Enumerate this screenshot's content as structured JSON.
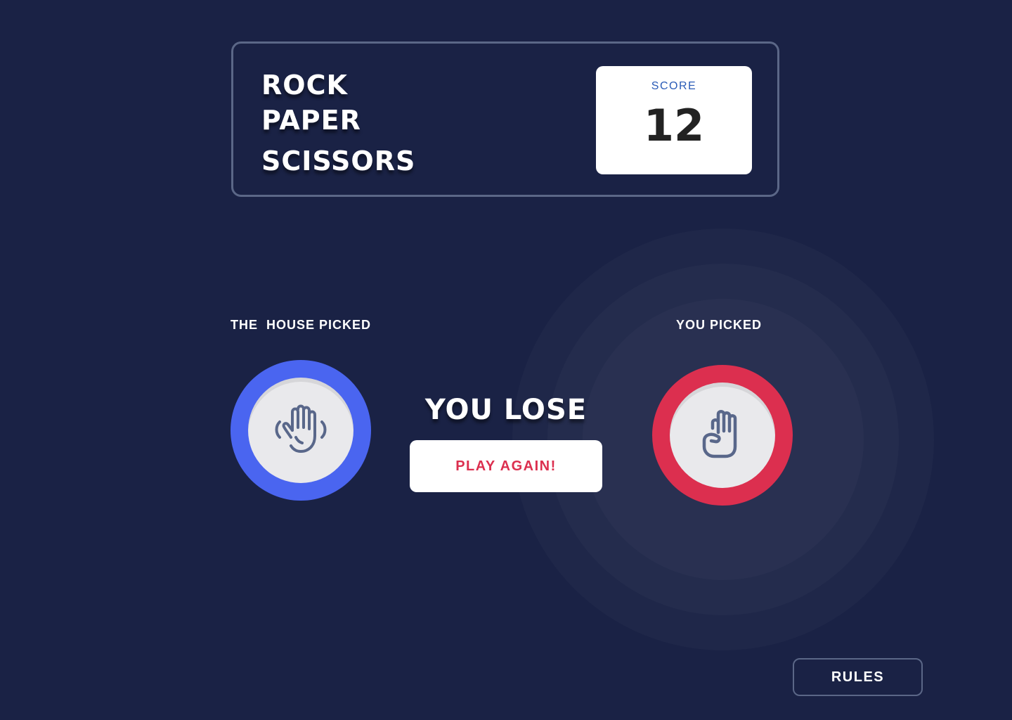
{
  "header": {
    "title_lines": [
      "ROCK",
      "PAPER",
      "SCISSORS"
    ],
    "score_label": "SCORE",
    "score_value": "12"
  },
  "house": {
    "label": "THE  HOUSE PICKED",
    "choice": "paper",
    "icon": "paper-hand-icon",
    "ring_color": "#4a65f0"
  },
  "player": {
    "label": "YOU PICKED",
    "choice": "rock",
    "icon": "rock-fist-icon",
    "ring_color": "#dc2f4f",
    "winner_halo": true
  },
  "result": {
    "title": "YOU LOSE",
    "play_again_label": "PLAY AGAIN!"
  },
  "footer": {
    "rules_label": "RULES"
  },
  "colors": {
    "background": "#1a2245",
    "header_border": "#5b6787",
    "score_label": "#2a5bb7",
    "play_again_text": "#dc2f4f",
    "icon_stroke": "#59678a"
  }
}
